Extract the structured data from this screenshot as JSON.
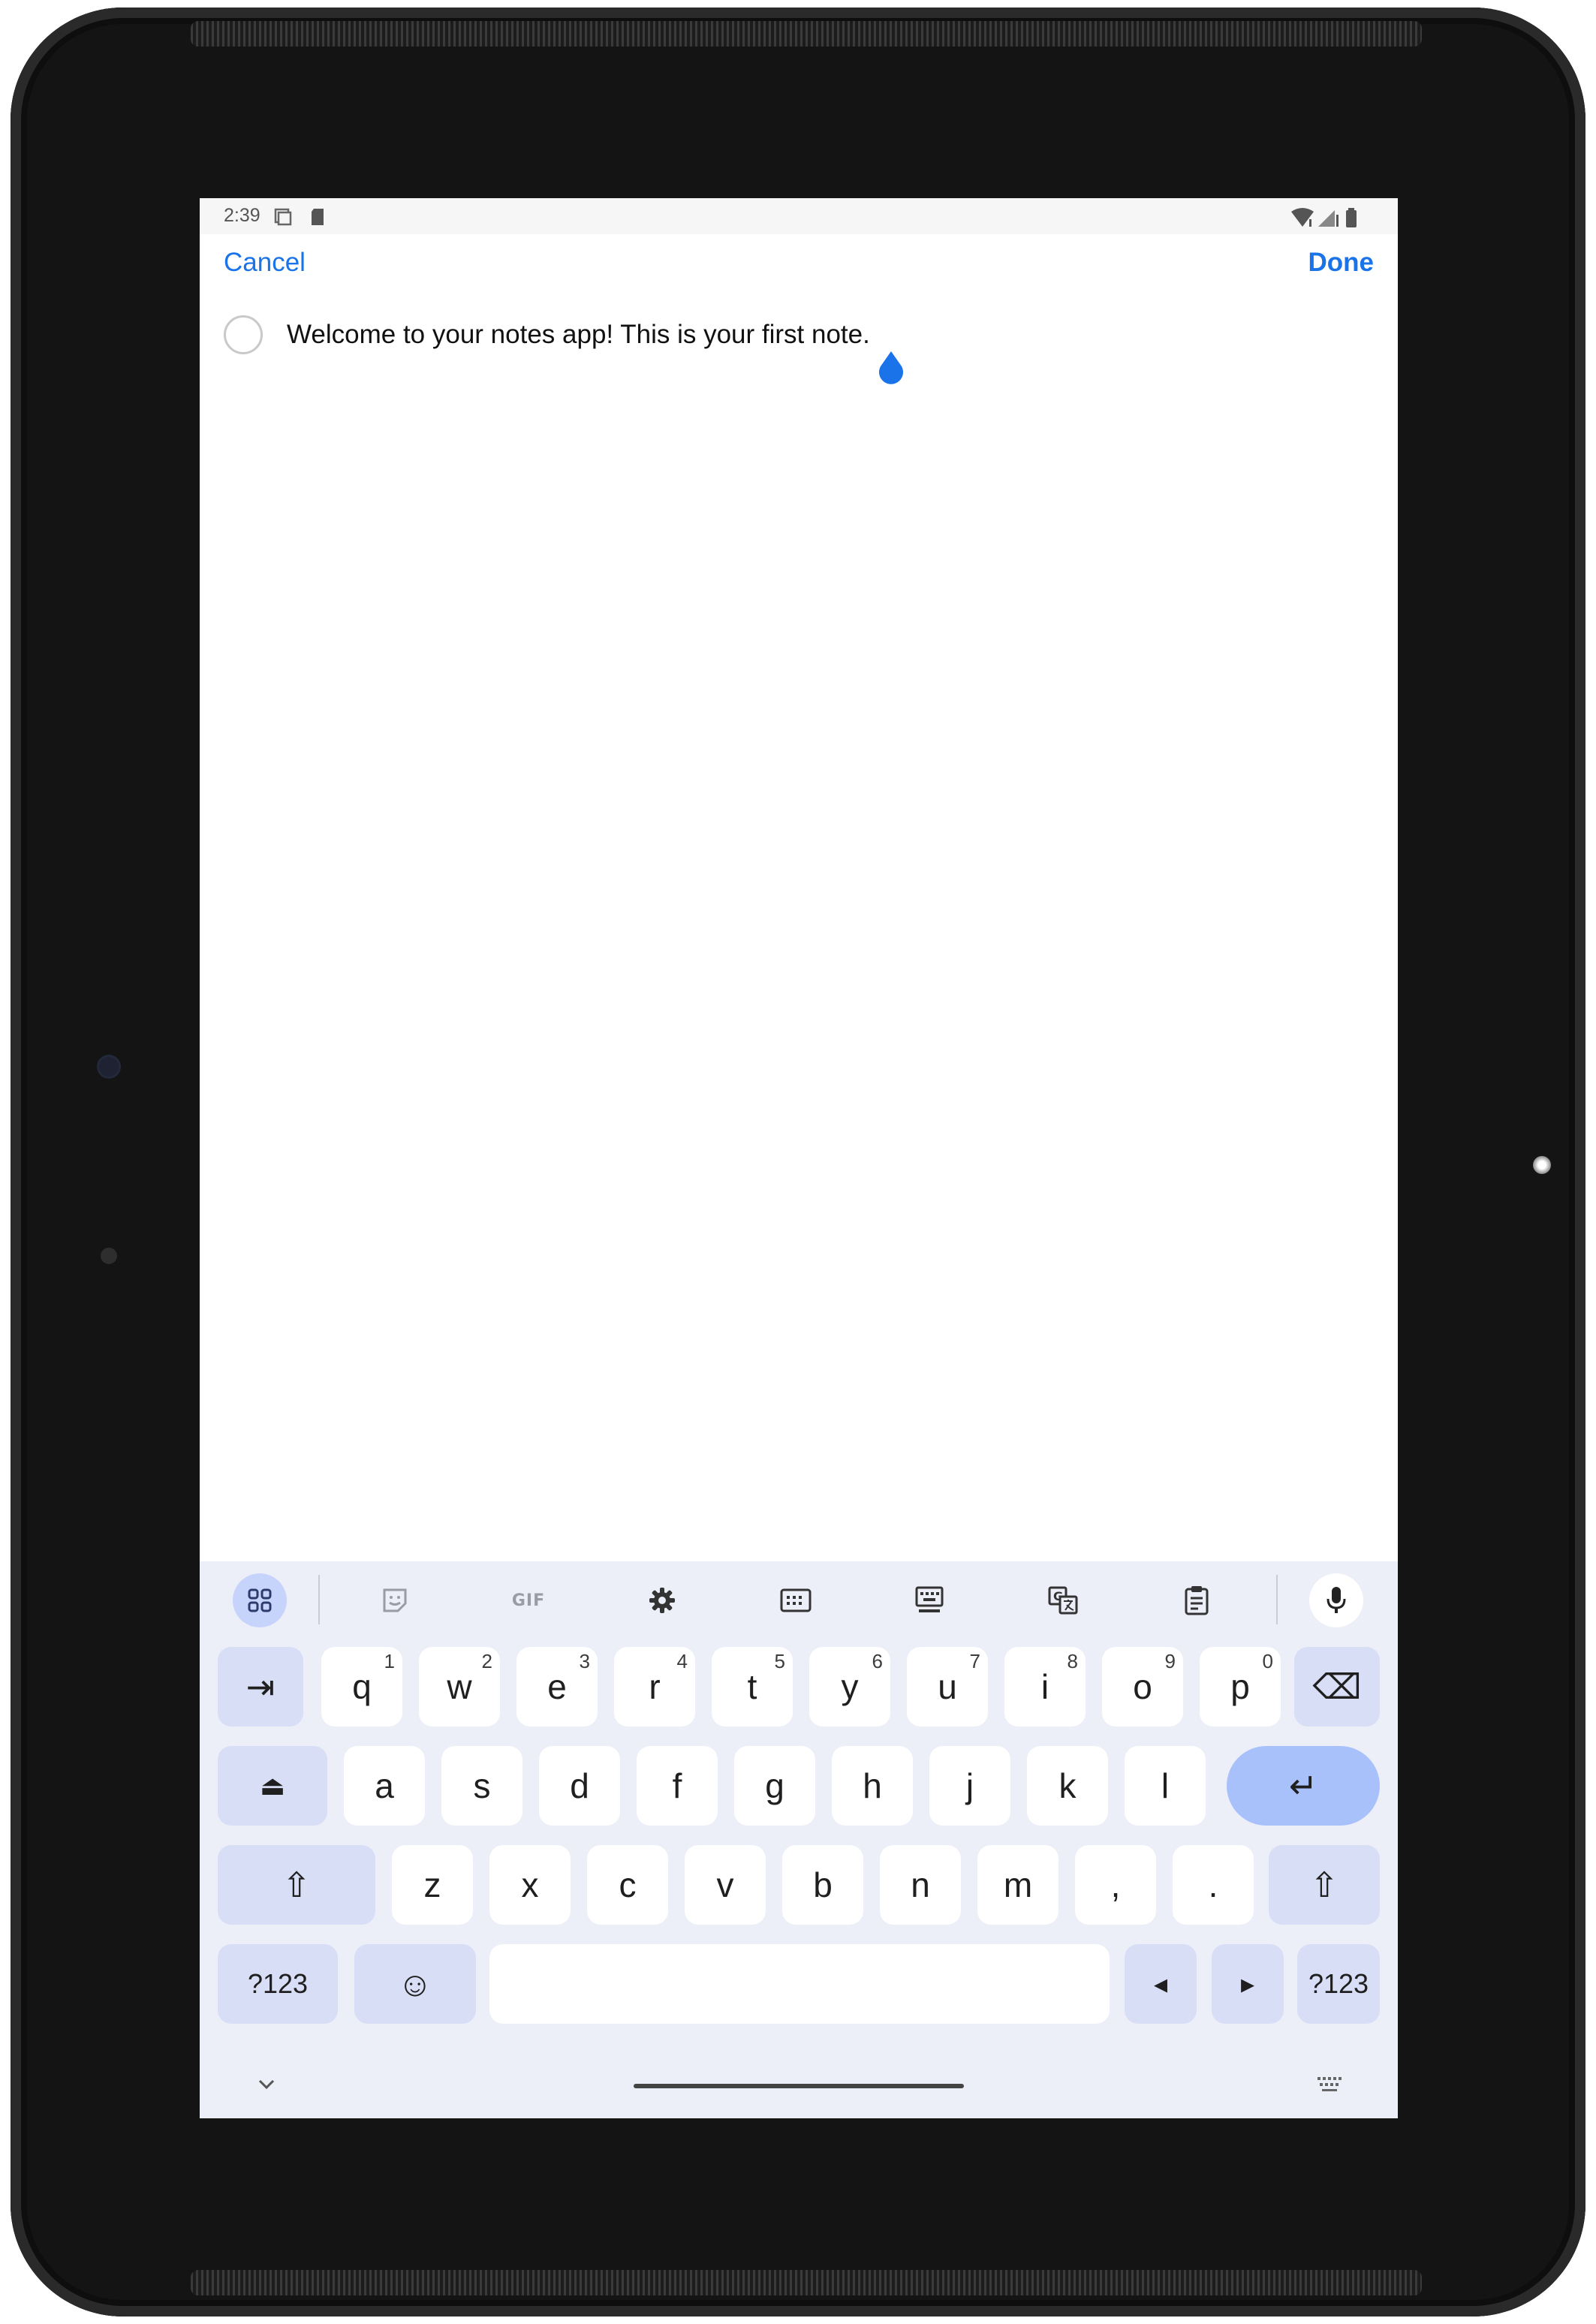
{
  "status_bar": {
    "time": "2:39",
    "icons": [
      "screen-record-icon",
      "sd-card-icon",
      "wifi-icon",
      "signal-icon",
      "battery-icon"
    ]
  },
  "header": {
    "cancel_label": "Cancel",
    "done_label": "Done"
  },
  "note": {
    "text": "Welcome to your notes app! This is your first note."
  },
  "keyboard": {
    "toolbar": {
      "gif_label": "GIF",
      "icons": [
        "apps-grid-icon",
        "sticker-icon",
        "gif-icon",
        "settings-icon",
        "one-handed-icon",
        "floating-keyboard-icon",
        "translate-icon",
        "clipboard-icon",
        "mic-icon"
      ]
    },
    "row1": [
      {
        "label": "⇥",
        "hint": ""
      },
      {
        "label": "q",
        "hint": "1"
      },
      {
        "label": "w",
        "hint": "2"
      },
      {
        "label": "e",
        "hint": "3"
      },
      {
        "label": "r",
        "hint": "4"
      },
      {
        "label": "t",
        "hint": "5"
      },
      {
        "label": "y",
        "hint": "6"
      },
      {
        "label": "u",
        "hint": "7"
      },
      {
        "label": "i",
        "hint": "8"
      },
      {
        "label": "o",
        "hint": "9"
      },
      {
        "label": "p",
        "hint": "0"
      },
      {
        "label": "⌫",
        "hint": ""
      }
    ],
    "row2": [
      "⏏",
      "a",
      "s",
      "d",
      "f",
      "g",
      "h",
      "j",
      "k",
      "l",
      "↵"
    ],
    "row3": [
      "⇧",
      "z",
      "x",
      "c",
      "v",
      "b",
      "n",
      "m",
      ",",
      ".",
      "⇧"
    ],
    "row4": {
      "symbols_left": "?123",
      "emoji": "☺",
      "space": "",
      "left_arrow": "◂",
      "right_arrow": "▸",
      "symbols_right": "?123"
    },
    "colors": {
      "background": "#eceef8",
      "key": "#ffffff",
      "modifier": "#d8def6",
      "enter": "#a9c1fb"
    }
  },
  "accent_color": "#1a73e8"
}
